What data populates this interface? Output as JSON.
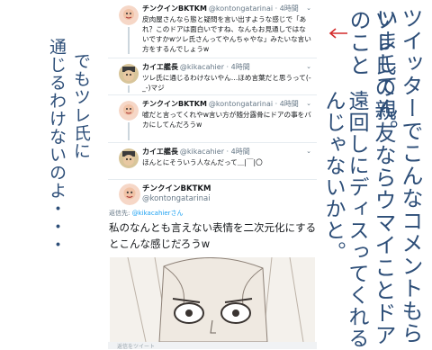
{
  "tweets": [
    {
      "name": "チンクインBKTKM",
      "handle": "@kontongatarinai · 4時間",
      "text": "皮肉屋さんなら態と疑問を言い出すような感じで「あれ？このドアは面白いですね、なんもお見通しではないですかwツレ氏さんってやんちゃやな」みたいな言い方をするんでしょうw"
    },
    {
      "name": "カイエ艦長",
      "handle": "@kikacahier · 4時間",
      "text": "ツレ氏に通じるわけないやん…ほめ言葉だと思うって(-_-)マジ"
    },
    {
      "name": "チンクインBKTKM",
      "handle": "@kontongatarinai · 4時間",
      "text": "嘘だと言ってくれやw言い方が随分露骨にドアの事をバカにしてんだろうw"
    },
    {
      "name": "カイエ艦長",
      "handle": "@kikacahier · 4時間",
      "text": "ほんとにそういう人なんだって＿|￣|〇"
    }
  ],
  "main_tweet": {
    "name": "チンクインBKTKM",
    "handle": "@kontongatarinai",
    "reply_prefix": "返信先: ",
    "reply_target": "@kikacahierさん",
    "text": "私のなんとも言えない表情を二次元化にするとこんな感じだろうw"
  },
  "bottom_bar_text": "返信をツイート",
  "annotations": {
    "right_col1": "ツイッターでこんなコメントもらいましてん。",
    "right_col2": "ツレ氏の親友ならウマイことドアのこと",
    "right_col3": "遠回しにディスってくれるんじゃないかと。",
    "left_col1": "でもツレ氏に",
    "left_col2": "通じるわけないのよ・・・",
    "left_col3": ""
  },
  "colors": {
    "accent": "#1da1f2",
    "handwriting": "#2d4e78",
    "divider": "#e6ecf0"
  }
}
